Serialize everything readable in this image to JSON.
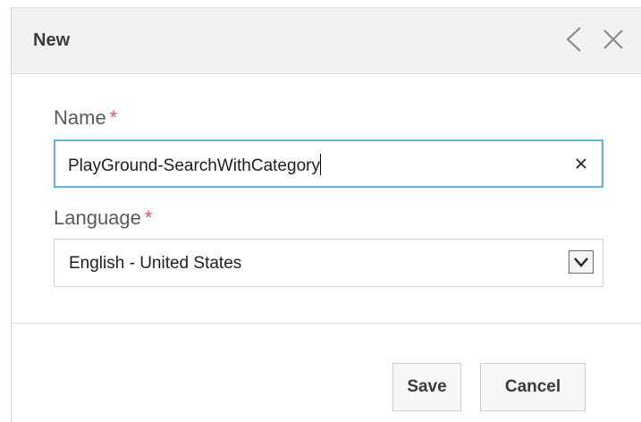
{
  "dialog": {
    "title": "New",
    "back_icon": "chevron-left-icon",
    "close_icon": "close-icon"
  },
  "form": {
    "name": {
      "label": "Name",
      "required_marker": "*",
      "value": "PlayGround-SearchWithCategory",
      "clear_icon": "clear-x-icon"
    },
    "language": {
      "label": "Language",
      "required_marker": "*",
      "selected": "English - United States",
      "dropdown_icon": "chevron-down-icon"
    }
  },
  "actions": {
    "save_label": "Save",
    "cancel_label": "Cancel"
  },
  "colors": {
    "header_bg": "#f2f2f2",
    "focus_border": "#5fb3e0",
    "required": "#e2574c"
  }
}
